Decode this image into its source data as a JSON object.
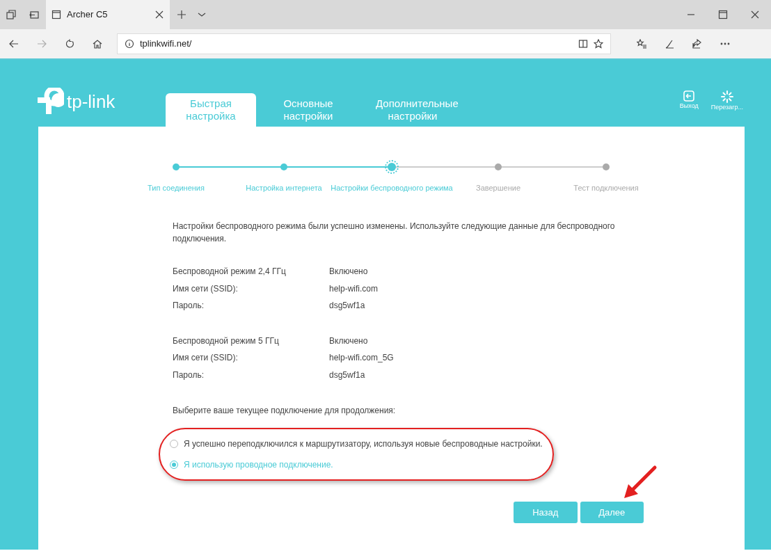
{
  "browser": {
    "tab_title": "Archer C5",
    "address": "tplinkwifi.net/"
  },
  "header": {
    "logo": "tp-link",
    "tabs": [
      {
        "label": "Быстрая настройка",
        "selected": true
      },
      {
        "label": "Основные настройки",
        "selected": false
      },
      {
        "label": "Дополнительные настройки",
        "selected": false
      }
    ],
    "actions": [
      {
        "kind": "logout",
        "label": "Выход"
      },
      {
        "kind": "reboot",
        "label": "Перезагр..."
      }
    ]
  },
  "steps": [
    {
      "label": "Тип соединения",
      "done": true,
      "selected": false
    },
    {
      "label": "Настройка интернета",
      "done": true,
      "selected": false
    },
    {
      "label": "Настройки беспроводного режима",
      "done": true,
      "selected": true
    },
    {
      "label": "Завершение",
      "done": false,
      "selected": false
    },
    {
      "label": "Тест подключения",
      "done": false,
      "selected": false
    }
  ],
  "message": "Настройки беспроводного режима были успешно изменены. Используйте следующие данные для беспроводного подключения.",
  "networks": [
    {
      "rows": [
        {
          "label": "Беспроводной режим 2,4 ГГц",
          "value": "Включено"
        },
        {
          "label": "Имя сети (SSID):",
          "value": "help-wifi.com"
        },
        {
          "label": "Пароль:",
          "value": "dsg5wf1a"
        }
      ]
    },
    {
      "rows": [
        {
          "label": "Беспроводной режим 5 ГГц",
          "value": "Включено"
        },
        {
          "label": "Имя сети (SSID):",
          "value": "help-wifi.com_5G"
        },
        {
          "label": "Пароль:",
          "value": "dsg5wf1a"
        }
      ]
    }
  ],
  "prompt": "Выберите ваше текущее подключение для продолжения:",
  "options": [
    {
      "label": "Я успешно переподключился к маршрутизатору, используя новые беспроводные настройки.",
      "selected": false
    },
    {
      "label": "Я использую проводное подключение.",
      "selected": true
    }
  ],
  "buttons": [
    "Назад",
    "Далее"
  ]
}
